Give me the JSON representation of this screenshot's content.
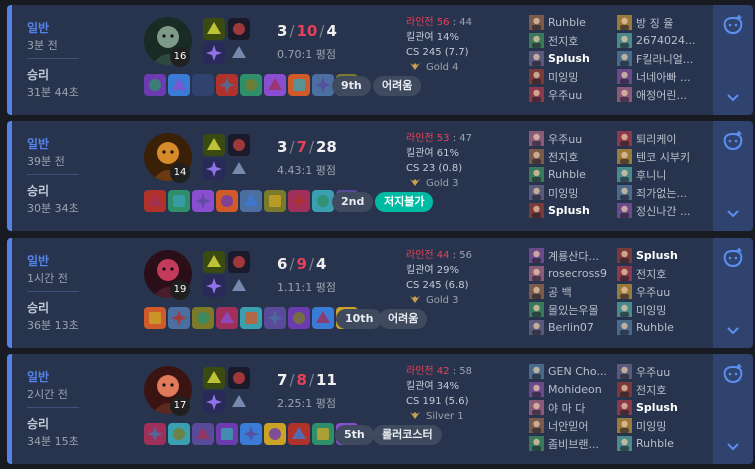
{
  "colors": {
    "win": "#5383e8",
    "loss": "#e84057",
    "card": "#28344e",
    "side": "#2f436e",
    "placeGreen": "#00bba3"
  },
  "icons": {
    "expand": "chevron-down-icon",
    "emoji": "emoji-add-icon",
    "tier": "tier-emblem-icon",
    "summoner": "summoner-spell-icon",
    "rune": "rune-icon",
    "item": "item-icon",
    "champion": "champion-portrait-icon"
  },
  "matches": [
    {
      "mode": "일반",
      "ago": "3분 전",
      "result": "승리",
      "duration": "31분 44초",
      "level": "16",
      "kills": "3",
      "deaths": "10",
      "assists": "4",
      "ratio": "0.70:1 평점",
      "lane_label": "라인전 56",
      "lane_sub": ": 44",
      "kp": "킬관여 14%",
      "cs": "CS 245 (7.7)",
      "tier": "Gold 4",
      "place": "9th",
      "tag": "어려움",
      "team1": [
        "Ruhble",
        "전지호",
        "Splush",
        "미잉밍",
        "우주uu"
      ],
      "team2": [
        "방 징 율",
        "2674024...",
        "F킬라니얼...",
        "너네아빠 ...",
        "애정어린..."
      ]
    },
    {
      "mode": "일반",
      "ago": "39분 전",
      "result": "승리",
      "duration": "30분 34초",
      "level": "14",
      "kills": "3",
      "deaths": "7",
      "assists": "28",
      "ratio": "4.43:1 평점",
      "lane_label": "라인전 53",
      "lane_sub": ": 47",
      "kp": "킬관여 61%",
      "cs": "CS 23 (0.8)",
      "tier": "Gold 3",
      "place": "2nd",
      "tag": "저지불가",
      "team1": [
        "우주uu",
        "전지호",
        "Ruhble",
        "미잉밍",
        "Splush"
      ],
      "team2": [
        "퇴리케이",
        "텐코 시부키",
        "후니니",
        "죄가없는...",
        "정신나간 ..."
      ]
    },
    {
      "mode": "일반",
      "ago": "1시간 전",
      "result": "승리",
      "duration": "36분 13초",
      "level": "19",
      "kills": "6",
      "deaths": "9",
      "assists": "4",
      "ratio": "1.11:1 평점",
      "lane_label": "라인전 44",
      "lane_sub": ": 56",
      "kp": "킬관여 29%",
      "cs": "CS 245 (6.8)",
      "tier": "Gold 3",
      "place": "10th",
      "tag": "어려움",
      "team1": [
        "계룡산다...",
        "rosecross9",
        "공 백",
        "몰있는우몰",
        "Berlin07"
      ],
      "team2": [
        "Splush",
        "전지호",
        "우주uu",
        "미잉밍",
        "Ruhble"
      ]
    },
    {
      "mode": "일반",
      "ago": "2시간 전",
      "result": "승리",
      "duration": "34분 15초",
      "level": "17",
      "kills": "7",
      "deaths": "8",
      "assists": "11",
      "ratio": "2.25:1 평점",
      "lane_label": "라인전 42",
      "lane_sub": ": 58",
      "kp": "킬관여 34%",
      "cs": "CS 191 (5.6)",
      "tier": "Silver 1",
      "place": "5th",
      "tag": "롤러코스터",
      "team1": [
        "GEN Cho...",
        "Mohideon",
        "야 마 다",
        "너안믿어",
        "좀비브랜..."
      ],
      "team2": [
        "우주uu",
        "전지호",
        "Splush",
        "미잉밍",
        "Ruhble"
      ]
    }
  ]
}
